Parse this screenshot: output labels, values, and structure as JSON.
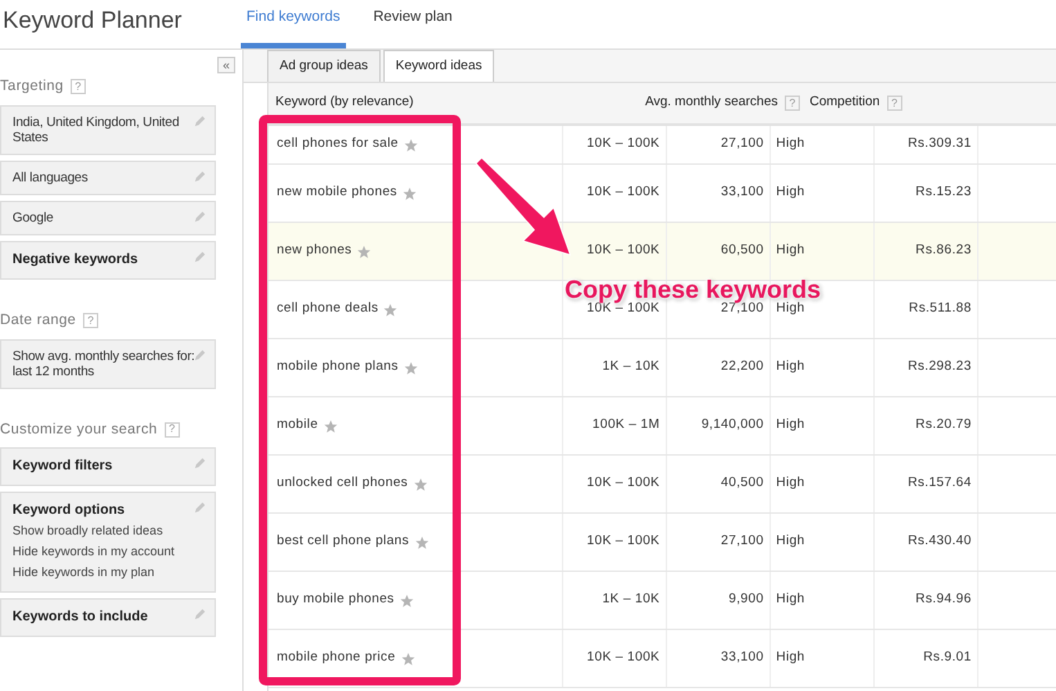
{
  "app_title": "Keyword Planner",
  "nav_tabs": [
    {
      "label": "Find keywords",
      "selected": true
    },
    {
      "label": "Review plan",
      "selected": false
    }
  ],
  "collapse_button": "«",
  "sidebar": [
    {
      "title": "Targeting",
      "help": "?",
      "cards": [
        {
          "kind": "plain",
          "text": "India, United Kingdom, United States"
        },
        {
          "kind": "plain",
          "text": "All languages"
        },
        {
          "kind": "plain",
          "text": "Google"
        },
        {
          "kind": "heading",
          "text": "Negative keywords"
        }
      ]
    },
    {
      "title": "Date range",
      "help": "?",
      "cards": [
        {
          "kind": "plain",
          "text": "Show avg. monthly searches for: last 12 months"
        }
      ]
    },
    {
      "title": "Customize your search",
      "help": "?",
      "cards": [
        {
          "kind": "heading",
          "text": "Keyword filters"
        },
        {
          "kind": "heading",
          "text": "Keyword options",
          "lines": [
            "Show broadly related ideas",
            "Hide keywords in my account",
            "Hide keywords in my plan"
          ]
        },
        {
          "kind": "heading",
          "text": "Keywords to include"
        }
      ]
    }
  ],
  "sub_tabs": [
    {
      "label": "Ad group ideas",
      "selected": false
    },
    {
      "label": "Keyword ideas",
      "selected": true
    }
  ],
  "table": {
    "columns": [
      {
        "label": "Keyword (by relevance)"
      },
      {
        "label": "Avg. monthly searches",
        "help": "?"
      },
      {
        "label": "Competition",
        "help": "?"
      }
    ],
    "rows": [
      {
        "keyword": "cell phones for sale",
        "column_2": "10K – 100K",
        "column_3": "27,100",
        "competition": "High",
        "column_5": "Rs.309.31",
        "highlighted": false
      },
      {
        "keyword": "new mobile phones",
        "column_2": "10K – 100K",
        "column_3": "33,100",
        "competition": "High",
        "column_5": "Rs.15.23",
        "highlighted": false
      },
      {
        "keyword": "new phones",
        "column_2": "10K – 100K",
        "column_3": "60,500",
        "competition": "High",
        "column_5": "Rs.86.23",
        "highlighted": true
      },
      {
        "keyword": "cell phone deals",
        "column_2": "10K – 100K",
        "column_3": "27,100",
        "competition": "High",
        "column_5": "Rs.511.88",
        "highlighted": false
      },
      {
        "keyword": "mobile phone plans",
        "column_2": "1K – 10K",
        "column_3": "22,200",
        "competition": "High",
        "column_5": "Rs.298.23",
        "highlighted": false
      },
      {
        "keyword": "mobile",
        "column_2": "100K – 1M",
        "column_3": "9,140,000",
        "competition": "High",
        "column_5": "Rs.20.79",
        "highlighted": false
      },
      {
        "keyword": "unlocked cell phones",
        "column_2": "10K – 100K",
        "column_3": "40,500",
        "competition": "High",
        "column_5": "Rs.157.64",
        "highlighted": false
      },
      {
        "keyword": "best cell phone plans",
        "column_2": "10K – 100K",
        "column_3": "27,100",
        "competition": "High",
        "column_5": "Rs.430.40",
        "highlighted": false
      },
      {
        "keyword": "buy mobile phones",
        "column_2": "1K – 10K",
        "column_3": "9,900",
        "competition": "High",
        "column_5": "Rs.94.96",
        "highlighted": false
      },
      {
        "keyword": "mobile phone price",
        "column_2": "10K – 100K",
        "column_3": "33,100",
        "competition": "High",
        "column_5": "Rs.9.01",
        "highlighted": false
      }
    ]
  },
  "annotation": {
    "text": "Copy these keywords"
  }
}
